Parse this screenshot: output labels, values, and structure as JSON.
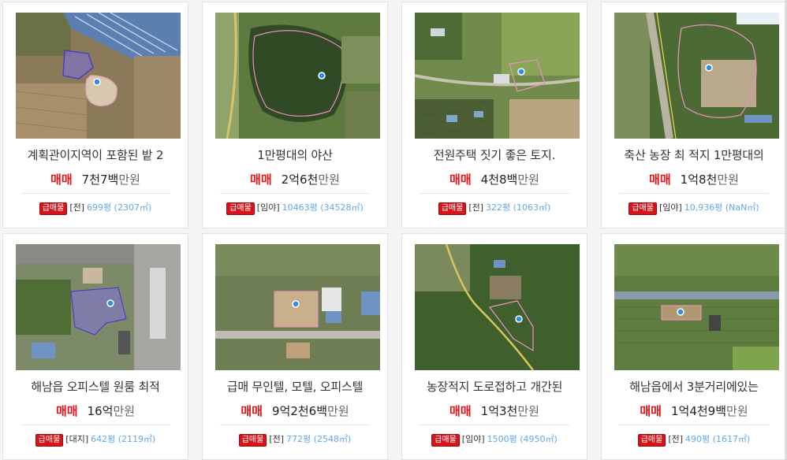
{
  "badge_label": "급매물",
  "price_unit": "만원",
  "listings": [
    {
      "title": "계획관이지역이 포함된 밭 2",
      "deal_type": "매매",
      "amount": "7천7백",
      "category": "[전]",
      "area": "699평 (2307㎡)",
      "map_icon": "location-pin-icon"
    },
    {
      "title": "1만평대의 야산",
      "deal_type": "매매",
      "amount": "2억6천",
      "category": "[임야]",
      "area": "10463평 (34528㎡)",
      "map_icon": "location-pin-icon"
    },
    {
      "title": "전원주택 짓기 좋은 토지.",
      "deal_type": "매매",
      "amount": "4천8백",
      "category": "[전]",
      "area": "322평 (1063㎡)",
      "map_icon": "location-pin-icon"
    },
    {
      "title": "축산 농장 최 적지 1만평대의",
      "deal_type": "매매",
      "amount": "1억8천",
      "category": "[임야]",
      "area": "10,936평 (NaN㎡)",
      "map_icon": "location-pin-icon"
    },
    {
      "title": "해남읍 오피스텔 원룸 최적",
      "deal_type": "매매",
      "amount": "16억",
      "category": "[대지]",
      "area": "642평 (2119㎡)",
      "map_icon": "location-pin-icon"
    },
    {
      "title": "급매 무인텔, 모텔, 오피스텔",
      "deal_type": "매매",
      "amount": "9억2천6백",
      "category": "[전]",
      "area": "772평 (2548㎡)",
      "map_icon": "location-pin-icon"
    },
    {
      "title": "농장적지 도로접하고 개간된",
      "deal_type": "매매",
      "amount": "1억3천",
      "category": "[임야]",
      "area": "1500평 (4950㎡)",
      "map_icon": "location-pin-icon"
    },
    {
      "title": "해남읍에서 3분거리에있는",
      "deal_type": "매매",
      "amount": "1억4천9백",
      "category": "[전]",
      "area": "490평 (1617㎡)",
      "map_icon": "location-pin-icon"
    }
  ]
}
